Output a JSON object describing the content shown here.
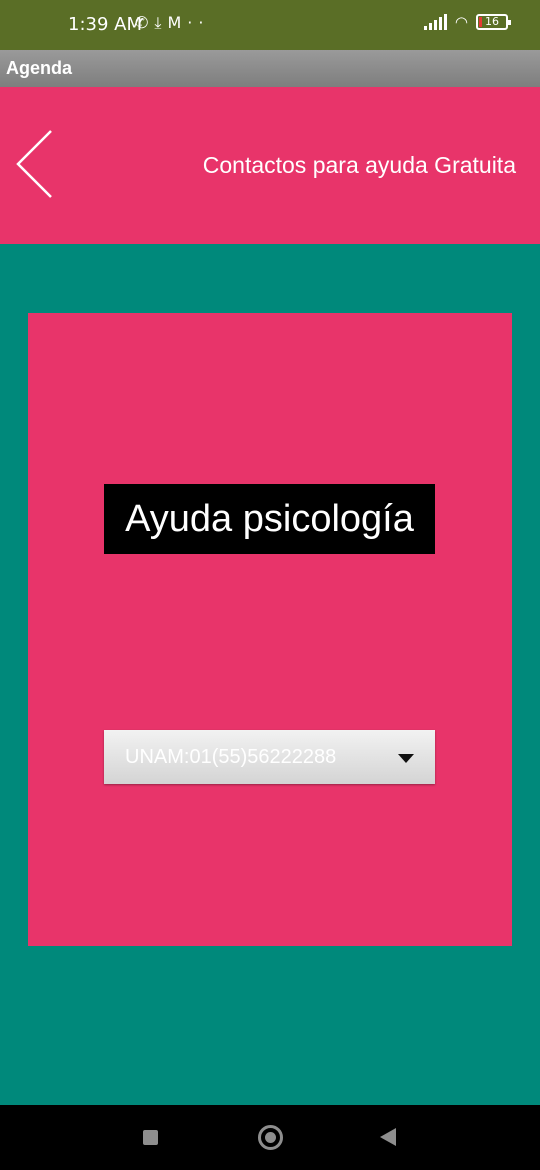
{
  "status_bar": {
    "time": "1:39 AM",
    "left_icons": [
      "whatsapp-icon",
      "download-icon",
      "gmail-icon",
      "more-dots-icon"
    ],
    "battery_level": "16"
  },
  "app": {
    "title": "Agenda"
  },
  "header": {
    "back_icon": "chevron-left-icon",
    "title": "Contactos para ayuda Gratuita"
  },
  "main": {
    "section_title": "Ayuda psicología",
    "contact_select": {
      "selected": "UNAM:01(55)56222288"
    }
  },
  "colors": {
    "status_bar": "#5A6E26",
    "titlebar": "#8A8A8A",
    "accent_pink": "#E8346A",
    "background_teal": "#00897B",
    "section_title_bg": "#000000",
    "nav_bar": "#000000"
  },
  "nav_bar": {
    "buttons": [
      "recents-icon",
      "home-icon",
      "back-icon"
    ]
  }
}
